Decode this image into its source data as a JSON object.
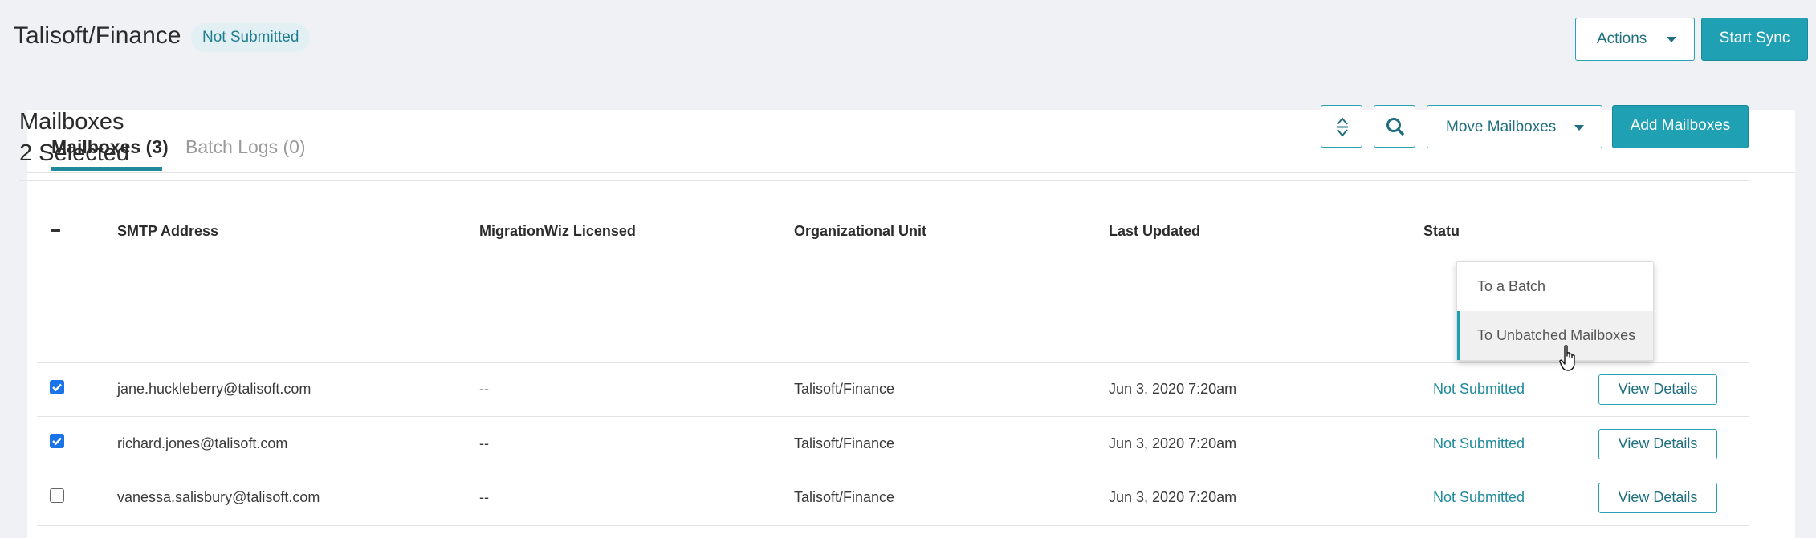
{
  "header": {
    "title": "Talisoft/Finance",
    "status_pill": "Not Submitted",
    "actions_label": "Actions",
    "start_sync_label": "Start Sync"
  },
  "tabs": [
    {
      "label": "Mailboxes (3)",
      "active": true
    },
    {
      "label": "Batch Logs (0)",
      "active": false
    }
  ],
  "section": {
    "title": "Mailboxes",
    "selected_count": "2 Selected",
    "move_label": "Move Mailboxes",
    "add_label": "Add Mailboxes"
  },
  "icons": {
    "sort": "sort-expand-icon",
    "search": "search-icon",
    "caret": "caret-down-icon",
    "cursor": "hand-pointer-cursor-icon"
  },
  "colors": {
    "accent": "#1fa0b3",
    "status_text": "#1f8a9b",
    "checkbox": "#1a73e8"
  },
  "table": {
    "headers": [
      "SMTP Address",
      "MigrationWiz Licensed",
      "Organizational Unit",
      "Last Updated",
      "Statu"
    ],
    "rows": [
      {
        "checked": true,
        "smtp": "jane.huckleberry@talisoft.com",
        "licensed": "--",
        "ou": "Talisoft/Finance",
        "updated": "Jun 3, 2020 7:20am",
        "status": "Not Submitted",
        "action": "View Details"
      },
      {
        "checked": true,
        "smtp": "richard.jones@talisoft.com",
        "licensed": "--",
        "ou": "Talisoft/Finance",
        "updated": "Jun 3, 2020 7:20am",
        "status": "Not Submitted",
        "action": "View Details"
      },
      {
        "checked": false,
        "smtp": "vanessa.salisbury@talisoft.com",
        "licensed": "--",
        "ou": "Talisoft/Finance",
        "updated": "Jun 3, 2020 7:20am",
        "status": "Not Submitted",
        "action": "View Details"
      }
    ]
  },
  "dropdown": {
    "items": [
      {
        "label": "To a Batch",
        "hover": false
      },
      {
        "label": "To Unbatched Mailboxes",
        "hover": true
      }
    ]
  }
}
